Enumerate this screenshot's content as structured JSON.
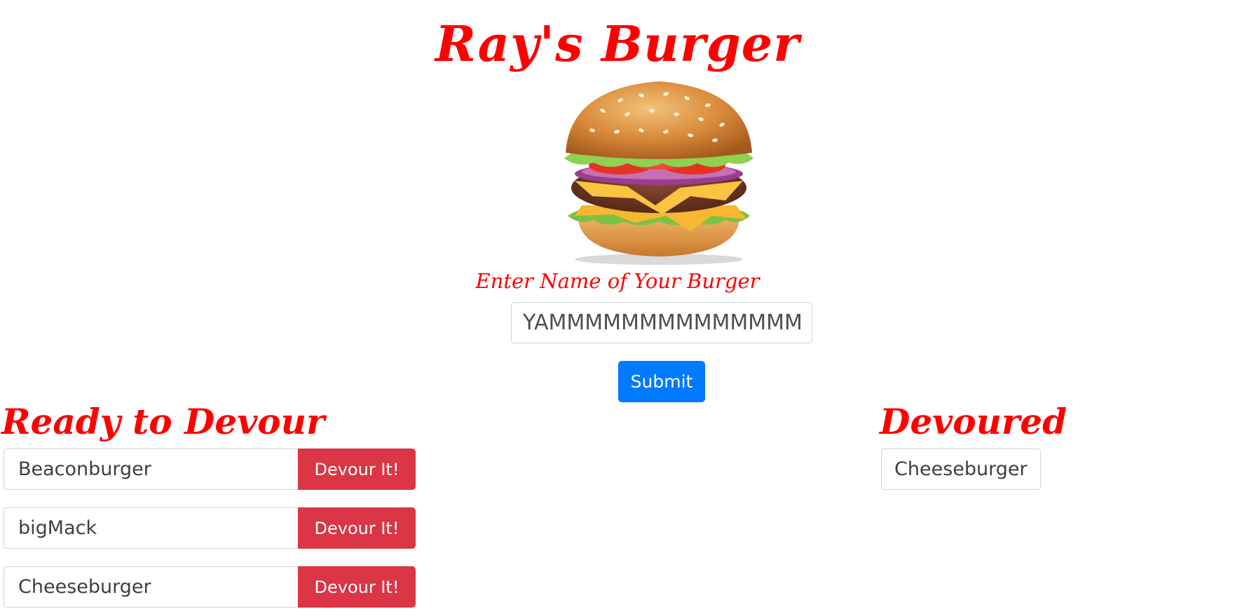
{
  "header": {
    "title": "Ray's Burger"
  },
  "hero": {
    "image_icon": "burger-illustration"
  },
  "form": {
    "label": "Enter Name of Your Burger",
    "input_value": "YAMMMMMMMMMMMMMMMMMMM",
    "input_placeholder": "",
    "submit_label": "Submit"
  },
  "ready": {
    "heading": "Ready to Devour",
    "items": [
      {
        "name": "Beaconburger",
        "button_label": "Devour It!"
      },
      {
        "name": "bigMack",
        "button_label": "Devour It!"
      },
      {
        "name": "Cheeseburger",
        "button_label": "Devour It!"
      }
    ]
  },
  "devoured": {
    "heading": "Devoured",
    "items": [
      {
        "name": "Cheeseburger"
      }
    ]
  },
  "colors": {
    "accent_red": "#ff0000",
    "submit_blue": "#007bff",
    "devour_red": "#dc3545"
  }
}
